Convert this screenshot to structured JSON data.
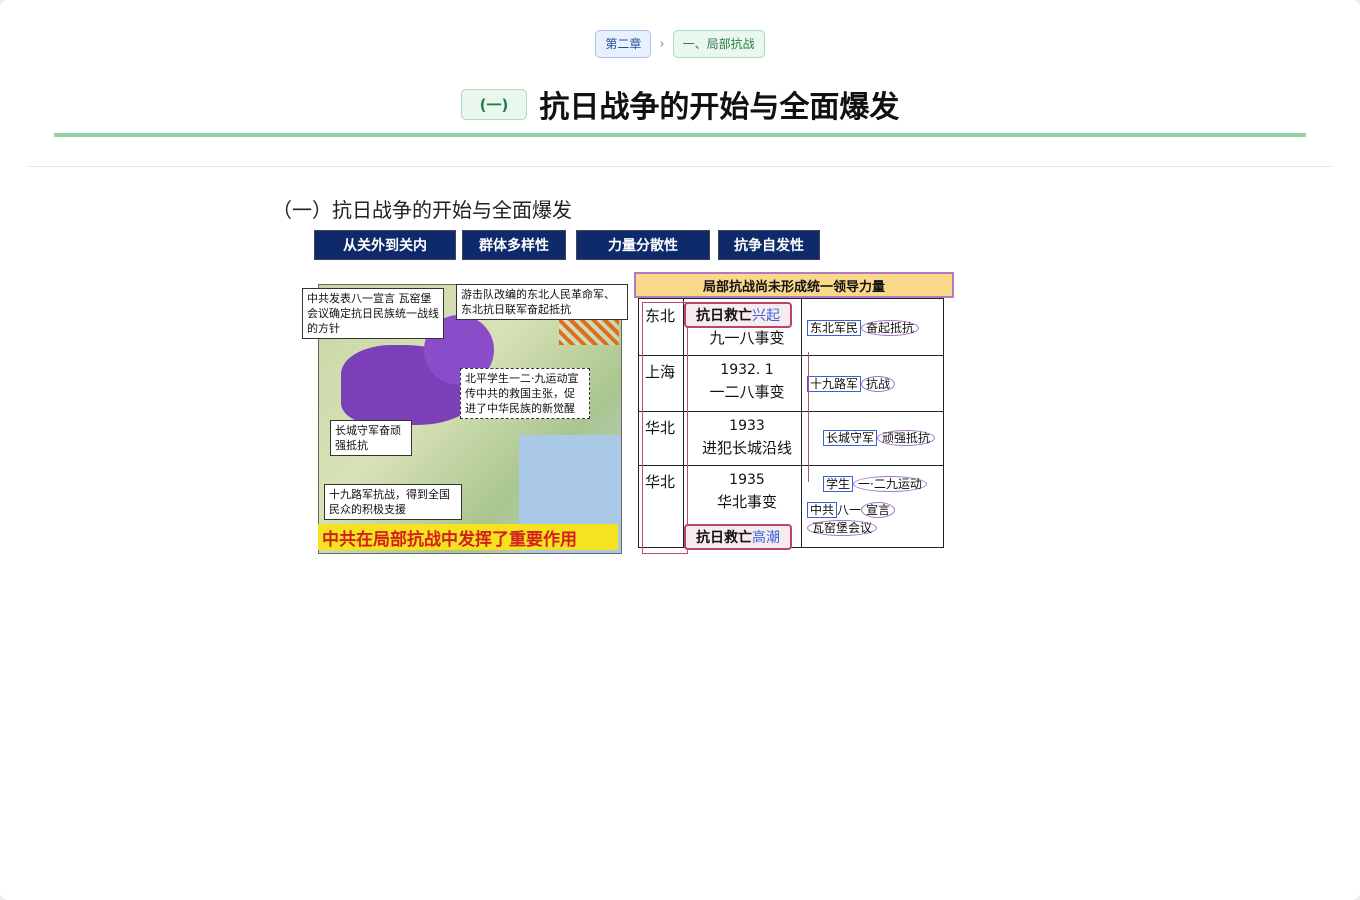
{
  "breadcrumb": {
    "chapter": "第二章",
    "section": "一、局部抗战"
  },
  "title": {
    "badge": "(一)",
    "text": "抗日战争的开始与全面爆发"
  },
  "subtitle": "（一）抗日战争的开始与全面爆发",
  "tags": [
    "从关外到关内",
    "群体多样性",
    "力量分散性",
    "抗争自发性"
  ],
  "map": {
    "callouts": [
      "中共发表八一宣言 瓦窑堡会议确定抗日民族统一战线的方针",
      "游击队改编的东北人民革命军、东北抗日联军奋起抵抗",
      "北平学生一二·九运动宣传中共的救国主张，促进了中华民族的新觉醒",
      "长城守军奋顽强抵抗",
      "十九路军抗战，得到全国民众的积极支援"
    ],
    "footer": "中共在局部抗战中发挥了重要作用"
  },
  "table": {
    "header": "局部抗战尚未形成统一领导力量",
    "top_pill": {
      "a": "抗日救亡",
      "b": "兴起"
    },
    "bottom_pill": {
      "a": "抗日救亡",
      "b": "高潮"
    },
    "rows": [
      {
        "region": "东北",
        "year": "",
        "event": "九一八事变",
        "note_box": "东北军民",
        "note_rest": "奋起抵抗"
      },
      {
        "region": "上海",
        "year": "1932. 1",
        "event": "一二八事变",
        "note_box": "十九路军",
        "note_rest": "抗战"
      },
      {
        "region": "华北",
        "year": "1933",
        "event": "进犯长城沿线",
        "note_box": "长城守军",
        "note_rest": "顽强抵抗"
      },
      {
        "region": "华北",
        "year": "1935",
        "event": "华北事变",
        "note_box": "学生",
        "note_rest": "一·二九运动"
      }
    ],
    "last_notes": {
      "box": "中共",
      "mid": "八一",
      "circ": "宣言",
      "line2": "瓦窑堡会议"
    }
  }
}
